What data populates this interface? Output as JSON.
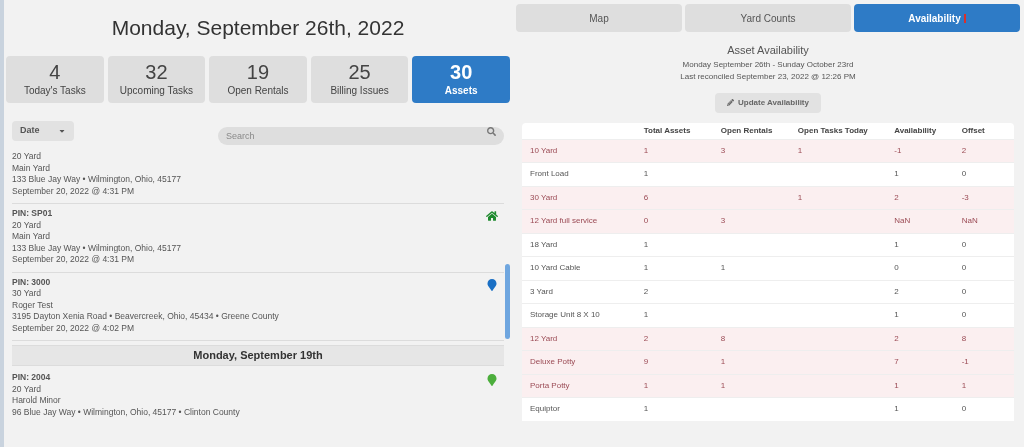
{
  "header": {
    "title": "Monday, September 26th, 2022"
  },
  "stats": [
    {
      "value": "4",
      "label": "Today's Tasks",
      "selected": false
    },
    {
      "value": "32",
      "label": "Upcoming Tasks",
      "selected": false
    },
    {
      "value": "19",
      "label": "Open Rentals",
      "selected": false
    },
    {
      "value": "25",
      "label": "Billing Issues",
      "selected": false
    },
    {
      "value": "30",
      "label": "Assets",
      "selected": true
    }
  ],
  "sort": {
    "label": "Date"
  },
  "search": {
    "placeholder": "Search"
  },
  "list": [
    {
      "kind": "task",
      "lines": [
        "20 Yard",
        "Main Yard",
        "133 Blue Jay Way • Wilmington, Ohio, 45177",
        "September 20, 2022 @ 4:31 PM"
      ]
    },
    {
      "kind": "home",
      "pin": "PIN: SP01",
      "color": "#1e8a2e",
      "lines": [
        "20 Yard",
        "Main Yard",
        "133 Blue Jay Way • Wilmington, Ohio, 45177",
        "September 20, 2022 @ 4:31 PM"
      ]
    },
    {
      "kind": "pin",
      "pin": "PIN: 3000",
      "color": "#1a6fc4",
      "lines": [
        "30 Yard",
        "Roger Test",
        "3195 Dayton Xenia Road • Beavercreek, Ohio, 45434 • Greene County",
        "September 20, 2022 @ 4:02 PM"
      ]
    },
    {
      "kind": "date",
      "title": "Monday, September 19th"
    },
    {
      "kind": "pin",
      "pin": "PIN: 2004",
      "color": "#4cae3c",
      "lines": [
        "20 Yard",
        "Harold Minor",
        "96 Blue Jay Way • Wilmington, Ohio, 45177 • Clinton County"
      ]
    }
  ],
  "tabs": [
    {
      "label": "Map",
      "selected": false,
      "alert": false
    },
    {
      "label": "Yard Counts",
      "selected": false,
      "alert": false
    },
    {
      "label": "Availability",
      "selected": true,
      "alert": true
    }
  ],
  "availability": {
    "title": "Asset Availability",
    "range": "Monday September 26th - Sunday October 23rd",
    "reconciled": "Last reconciled September 23, 2022 @ 12:26 PM",
    "button": "Update Availability",
    "columns": [
      "",
      "Total Assets",
      "Open Rentals",
      "Open Tasks Today",
      "Availability",
      "Offset"
    ],
    "rows": [
      {
        "flagged": true,
        "cells": [
          "10 Yard",
          "1",
          "3",
          "1",
          "-1",
          "2"
        ]
      },
      {
        "flagged": false,
        "cells": [
          "Front Load",
          "1",
          "",
          "",
          "1",
          "0"
        ]
      },
      {
        "flagged": true,
        "cells": [
          "30 Yard",
          "6",
          "",
          "1",
          "2",
          "-3"
        ]
      },
      {
        "flagged": true,
        "cells": [
          "12 Yard full service",
          "0",
          "3",
          "",
          "NaN",
          "NaN"
        ]
      },
      {
        "flagged": false,
        "cells": [
          "18 Yard",
          "1",
          "",
          "",
          "1",
          "0"
        ]
      },
      {
        "flagged": false,
        "cells": [
          "10 Yard Cable",
          "1",
          "1",
          "",
          "0",
          "0"
        ]
      },
      {
        "flagged": false,
        "cells": [
          "3 Yard",
          "2",
          "",
          "",
          "2",
          "0"
        ]
      },
      {
        "flagged": false,
        "cells": [
          "Storage Unit 8 X 10",
          "1",
          "",
          "",
          "1",
          "0"
        ]
      },
      {
        "flagged": true,
        "cells": [
          "12 Yard",
          "2",
          "8",
          "",
          "2",
          "8"
        ]
      },
      {
        "flagged": true,
        "cells": [
          "Deluxe Potty",
          "9",
          "1",
          "",
          "7",
          "-1"
        ]
      },
      {
        "flagged": true,
        "cells": [
          "Porta Potty",
          "1",
          "1",
          "",
          "1",
          "1"
        ]
      },
      {
        "flagged": false,
        "cells": [
          "Equiptor",
          "1",
          "",
          "",
          "1",
          "0"
        ]
      }
    ]
  }
}
